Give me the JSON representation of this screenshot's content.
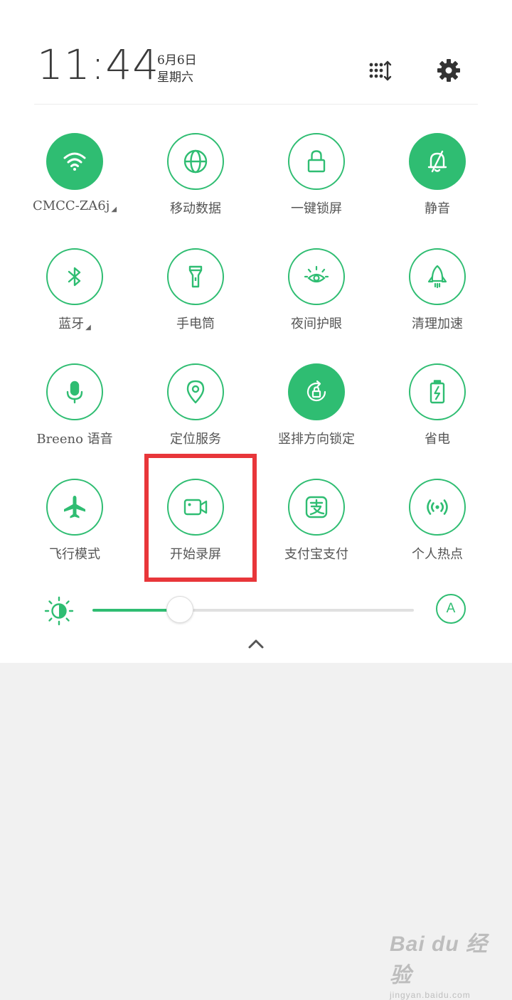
{
  "header": {
    "time": "11:44",
    "date": "6月6日",
    "weekday": "星期六",
    "edit_icon": "grid-sort-icon",
    "settings_icon": "gear-icon"
  },
  "tiles": [
    {
      "label": "CMCC-ZA6j",
      "icon": "wifi-icon",
      "active": true,
      "has_more": true
    },
    {
      "label": "移动数据",
      "icon": "globe-icon",
      "active": false
    },
    {
      "label": "一键锁屏",
      "icon": "lock-icon",
      "active": false
    },
    {
      "label": "静音",
      "icon": "bell-off-icon",
      "active": true
    },
    {
      "label": "蓝牙",
      "icon": "bluetooth-icon",
      "active": false,
      "has_more": true
    },
    {
      "label": "手电筒",
      "icon": "flashlight-icon",
      "active": false
    },
    {
      "label": "夜间护眼",
      "icon": "eye-icon",
      "active": false
    },
    {
      "label": "清理加速",
      "icon": "rocket-icon",
      "active": false
    },
    {
      "label": "Breeno 语音",
      "icon": "microphone-icon",
      "active": false
    },
    {
      "label": "定位服务",
      "icon": "location-pin-icon",
      "active": false
    },
    {
      "label": "竖排方向锁定",
      "icon": "rotation-lock-icon",
      "active": true
    },
    {
      "label": "省电",
      "icon": "battery-saver-icon",
      "active": false
    },
    {
      "label": "飞行模式",
      "icon": "airplane-icon",
      "active": false
    },
    {
      "label": "开始录屏",
      "icon": "video-camera-icon",
      "active": false,
      "highlighted": true
    },
    {
      "label": "支付宝支付",
      "icon": "alipay-icon",
      "active": false
    },
    {
      "label": "个人热点",
      "icon": "hotspot-icon",
      "active": false
    }
  ],
  "brightness": {
    "level": 0.27,
    "auto_label": "A"
  },
  "watermark": {
    "brand": "Bai du 经验",
    "sub": "jingyan.baidu.com"
  },
  "colors": {
    "accent": "#2fbd72",
    "highlight": "#e8363a",
    "panel": "#ffffff",
    "background": "#f1f1f1"
  }
}
